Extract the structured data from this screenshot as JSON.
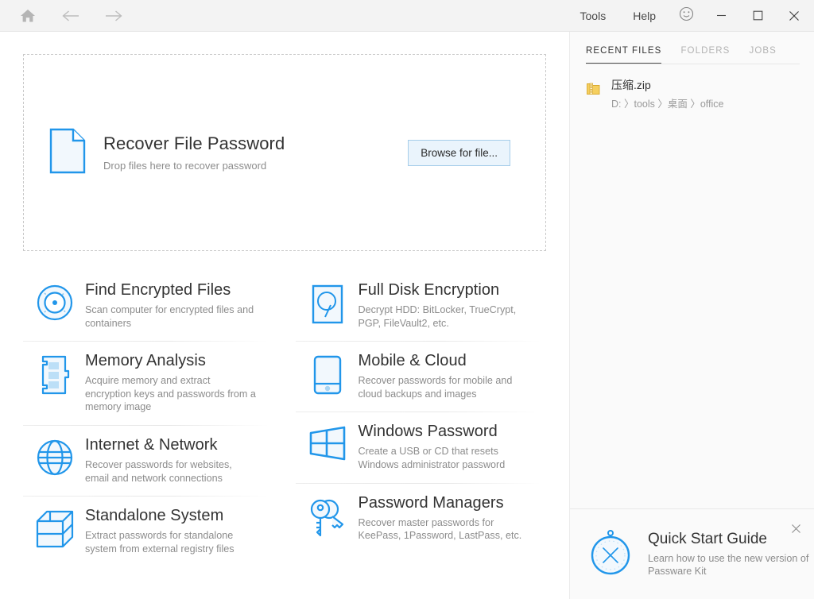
{
  "titlebar": {
    "nav": {
      "home_icon": "home-icon",
      "back_icon": "arrow-left-icon",
      "forward_icon": "arrow-right-icon"
    },
    "menus": [
      {
        "label": "Tools"
      },
      {
        "label": "Help"
      }
    ],
    "feedback_icon": "smiley-face-icon",
    "window_controls": {
      "minimize": "—",
      "maximize": "☐",
      "close": "✕"
    }
  },
  "dropzone": {
    "icon": "file-document-icon",
    "title": "Recover File Password",
    "subtitle": "Drop files here to recover password",
    "browse_label": "Browse for file..."
  },
  "tiles": {
    "left": [
      {
        "icon": "radar-scan-icon",
        "title": "Find Encrypted Files",
        "desc": "Scan computer for encrypted files and containers"
      },
      {
        "icon": "memory-stick-icon",
        "title": "Memory Analysis",
        "desc": "Acquire memory and extract encryption keys and passwords from a memory image"
      },
      {
        "icon": "globe-network-icon",
        "title": "Internet & Network",
        "desc": "Recover passwords for websites, email and network connections"
      },
      {
        "icon": "cube-blocks-icon",
        "title": "Standalone System",
        "desc": "Extract passwords for standalone system from external registry files"
      }
    ],
    "right": [
      {
        "icon": "hard-disk-icon",
        "title": "Full Disk Encryption",
        "desc": "Decrypt HDD: BitLocker, TrueCrypt, PGP, FileVault2, etc."
      },
      {
        "icon": "mobile-phone-icon",
        "title": "Mobile & Cloud",
        "desc": "Recover passwords for mobile and cloud backups and images"
      },
      {
        "icon": "windows-logo-icon",
        "title": "Windows Password",
        "desc": "Create a USB or CD that resets Windows administrator password"
      },
      {
        "icon": "keys-icon",
        "title": "Password Managers",
        "desc": "Recover master passwords for KeePass, 1Password, LastPass, etc."
      }
    ]
  },
  "right_panel": {
    "tabs": [
      {
        "label": "RECENT FILES",
        "active": true
      },
      {
        "label": "FOLDERS",
        "active": false
      },
      {
        "label": "JOBS",
        "active": false
      }
    ],
    "files": [
      {
        "icon": "zip-archive-icon",
        "name": "压缩.zip",
        "path": "D: 〉tools 〉桌面 〉office"
      }
    ]
  },
  "quickstart": {
    "icon": "compass-icon",
    "title": "Quick Start Guide",
    "subtitle": "Learn how to use the new version of Passware Kit",
    "close_icon": "close-icon"
  },
  "colors": {
    "accent_blue": "#2196ea",
    "icon_fill": "#f2f8fd",
    "titlebar_bg": "#f3f3f3",
    "panel_bg": "#fafafa",
    "button_bg": "#eaf4fc",
    "button_border": "#a6cdea",
    "title_text": "#333333",
    "muted_text": "#8c8c8c",
    "zip_yellow": "#f2c94c"
  }
}
